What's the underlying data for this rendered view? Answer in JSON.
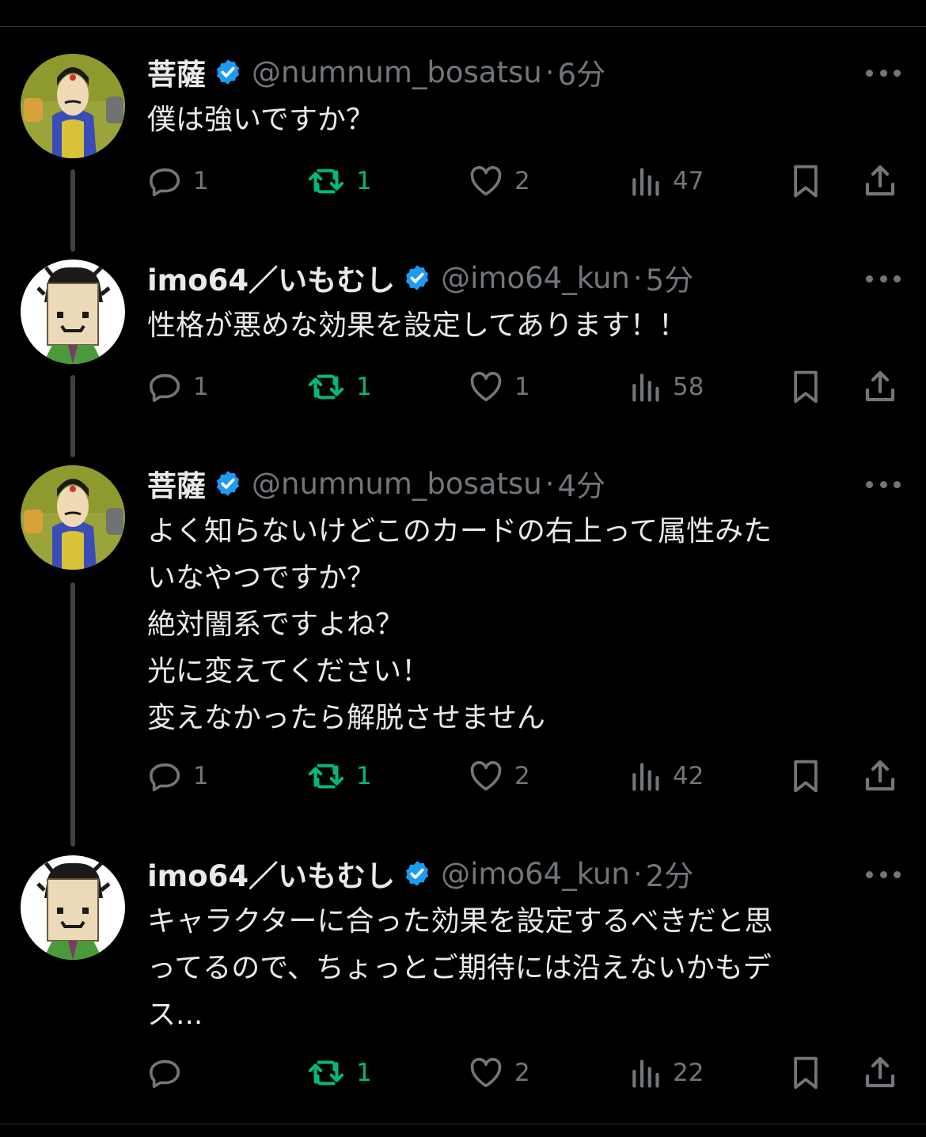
{
  "colors": {
    "background": "#000000",
    "text": "#e7e9ea",
    "muted": "#71767b",
    "verified": "#1d9bf0",
    "retweet": "#00ba7c"
  },
  "tweets": [
    {
      "author": "菩薩",
      "handle": "@numnum_bosatsu",
      "sep": "·",
      "time": "6分",
      "lines": [
        "僕は強いですか？"
      ],
      "stats": {
        "replies": "1",
        "retweets": "1",
        "likes": "2",
        "views": "47"
      }
    },
    {
      "author": "imo64／いもむし",
      "handle": "@imo64_kun",
      "sep": "·",
      "time": "5分",
      "lines": [
        "性格が悪めな効果を設定してあります！！"
      ],
      "stats": {
        "replies": "1",
        "retweets": "1",
        "likes": "1",
        "views": "58"
      }
    },
    {
      "author": "菩薩",
      "handle": "@numnum_bosatsu",
      "sep": "·",
      "time": "4分",
      "lines": [
        "よく知らないけどこのカードの右上って属性みた",
        "いなやつですか？",
        "絶対闇系ですよね？",
        "光に変えてください！",
        "変えなかったら解脱させません"
      ],
      "stats": {
        "replies": "1",
        "retweets": "1",
        "likes": "2",
        "views": "42"
      }
    },
    {
      "author": "imo64／いもむし",
      "handle": "@imo64_kun",
      "sep": "·",
      "time": "2分",
      "lines": [
        "キャラクターに合った効果を設定するべきだと思",
        "ってるので、ちょっとご期待には沿えないかもデ",
        "ス..."
      ],
      "stats": {
        "replies": "",
        "retweets": "1",
        "likes": "2",
        "views": "22"
      }
    }
  ]
}
